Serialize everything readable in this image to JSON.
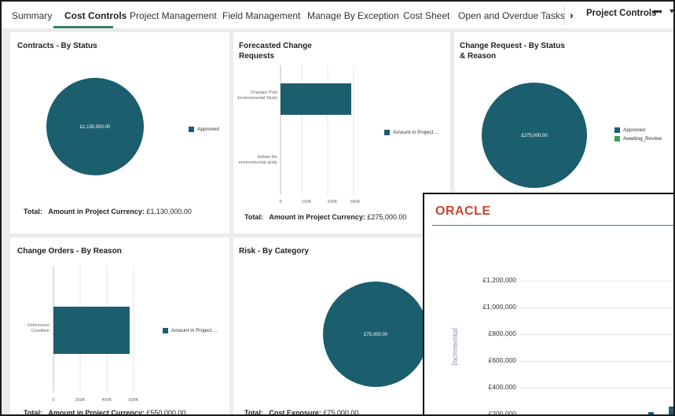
{
  "tabs": [
    {
      "label": "Summary",
      "active": false
    },
    {
      "label": "Cost Controls",
      "active": true
    },
    {
      "label": "Project Management",
      "active": false
    },
    {
      "label": "Field Management",
      "active": false
    },
    {
      "label": "Manage By Exception",
      "active": false
    },
    {
      "label": "Cost Sheet",
      "active": false
    },
    {
      "label": "Open and Overdue Tasks",
      "active": false
    }
  ],
  "header": {
    "chevron": "›",
    "project_controls": "Project Controls",
    "more_icon": "more-icon",
    "caret_icon": "caret-down-icon"
  },
  "colors": {
    "teal": "#1b5e6e",
    "green": "#3e9b5c",
    "oracle_red": "#c74634",
    "accent": "#3a7e6d"
  },
  "cards": {
    "contracts": {
      "title": "Contracts - By Status",
      "pie_label": "£1,130,000.00",
      "legend": [
        "Approved"
      ],
      "total_label": "Total:",
      "total_field": "Amount in Project Currency:",
      "total_value": "£1,130,000.00"
    },
    "forecasted": {
      "title_line1": "Forecasted Change",
      "title_line2": "Requests",
      "categories": [
        "Changes Post Environmental Study",
        "Initiate the environmental study"
      ],
      "ticks": [
        "0",
        "100K",
        "200K",
        "300K"
      ],
      "legend": [
        "Amount in Project ..."
      ],
      "total_label": "Total:",
      "total_field": "Amount in Project Currency:",
      "total_value": "£275,000.00"
    },
    "change_request": {
      "title_line1": "Change Request - By Status",
      "title_line2": "& Reason",
      "pie_label": "£275,000.00",
      "legend": [
        "Approved",
        "Awaiting_Review"
      ]
    },
    "change_orders": {
      "title": "Change Orders - By Reason",
      "category_line1": "Unforeseen",
      "category_line2": "Condition",
      "ticks": [
        "0",
        "200K",
        "400K",
        "600K"
      ],
      "legend": [
        "Amount in Project ..."
      ],
      "total_label": "Total:",
      "total_field": "Amount in Project Currency:",
      "total_value": "£550,000.00"
    },
    "risk": {
      "title": "Risk - By Category",
      "pie_label": "£75,000.00",
      "total_label": "Total:",
      "total_field": "Cost Exposure:",
      "total_value": "£75,000.00"
    }
  },
  "oracle": {
    "logo": "ORACLE",
    "yaxis_title": "Incremental",
    "ticks": [
      "£1,200,000",
      "£1,000,000",
      "£800,000",
      "£600,000",
      "£400,000",
      "£200,000"
    ]
  },
  "chart_data": [
    {
      "type": "pie",
      "title": "Contracts - By Status",
      "labels": [
        "Approved"
      ],
      "values": [
        1130000
      ]
    },
    {
      "type": "bar",
      "title": "Forecasted Change Requests",
      "categories": [
        "Changes Post Environmental Study",
        "Initiate the environmental study"
      ],
      "series": [
        {
          "name": "Amount in Project ...",
          "values": [
            275000,
            0
          ]
        }
      ],
      "xlim": [
        0,
        300000
      ]
    },
    {
      "type": "pie",
      "title": "Change Request - By Status & Reason",
      "labels": [
        "Approved",
        "Awaiting_Review"
      ],
      "values": [
        275000,
        0
      ]
    },
    {
      "type": "bar",
      "title": "Change Orders - By Reason",
      "categories": [
        "Unforeseen Condition"
      ],
      "series": [
        {
          "name": "Amount in Project ...",
          "values": [
            550000
          ]
        }
      ],
      "xlim": [
        0,
        600000
      ]
    },
    {
      "type": "pie",
      "title": "Risk - By Category",
      "labels": [
        ""
      ],
      "values": [
        75000
      ]
    }
  ]
}
